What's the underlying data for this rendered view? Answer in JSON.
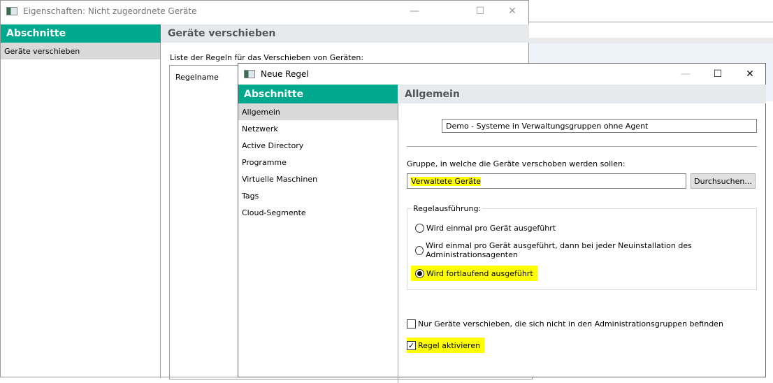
{
  "outer_window": {
    "title": "Eigenschaften: Nicht zugeordnete Geräte",
    "sidebar_header": "Abschnitte",
    "sidebar_items": [
      {
        "label": "Geräte verschieben",
        "selected": true
      }
    ],
    "section_title": "Geräte verschieben",
    "list_label": "Liste der Regeln für das Verschieben von Geräten:",
    "list_column": "Regelname"
  },
  "dialog": {
    "title": "Neue Regel",
    "sidebar_header": "Abschnitte",
    "sidebar_items": [
      {
        "label": "Allgemein",
        "selected": true
      },
      {
        "label": "Netzwerk"
      },
      {
        "label": "Active Directory"
      },
      {
        "label": "Programme"
      },
      {
        "label": "Virtuelle Maschinen"
      },
      {
        "label": "Tags"
      },
      {
        "label": "Cloud-Segmente"
      }
    ],
    "section_title": "Allgemein",
    "rule_name": "Demo -  Systeme in Verwaltungsgruppen ohne Agent",
    "group_label": "Gruppe, in welche die Geräte verschoben werden sollen:",
    "group_value": "Verwaltete Geräte",
    "browse_button": "Durchsuchen...",
    "execution_legend": "Regelausführung:",
    "execution_options": [
      {
        "label": "Wird einmal pro Gerät ausgeführt",
        "checked": false
      },
      {
        "label": "Wird einmal pro Gerät ausgeführt, dann bei jeder Neuinstallation des Administrationsagenten",
        "checked": false
      },
      {
        "label": "Wird fortlaufend ausgeführt",
        "checked": true
      }
    ],
    "only_unassigned": {
      "label": "Nur Geräte verschieben, die sich nicht in den Administrationsgruppen befinden",
      "checked": false
    },
    "enable_rule": {
      "label": "Regel aktivieren",
      "checked": true
    }
  },
  "colors": {
    "accent": "#00a88e",
    "highlight": "#ffff00"
  }
}
